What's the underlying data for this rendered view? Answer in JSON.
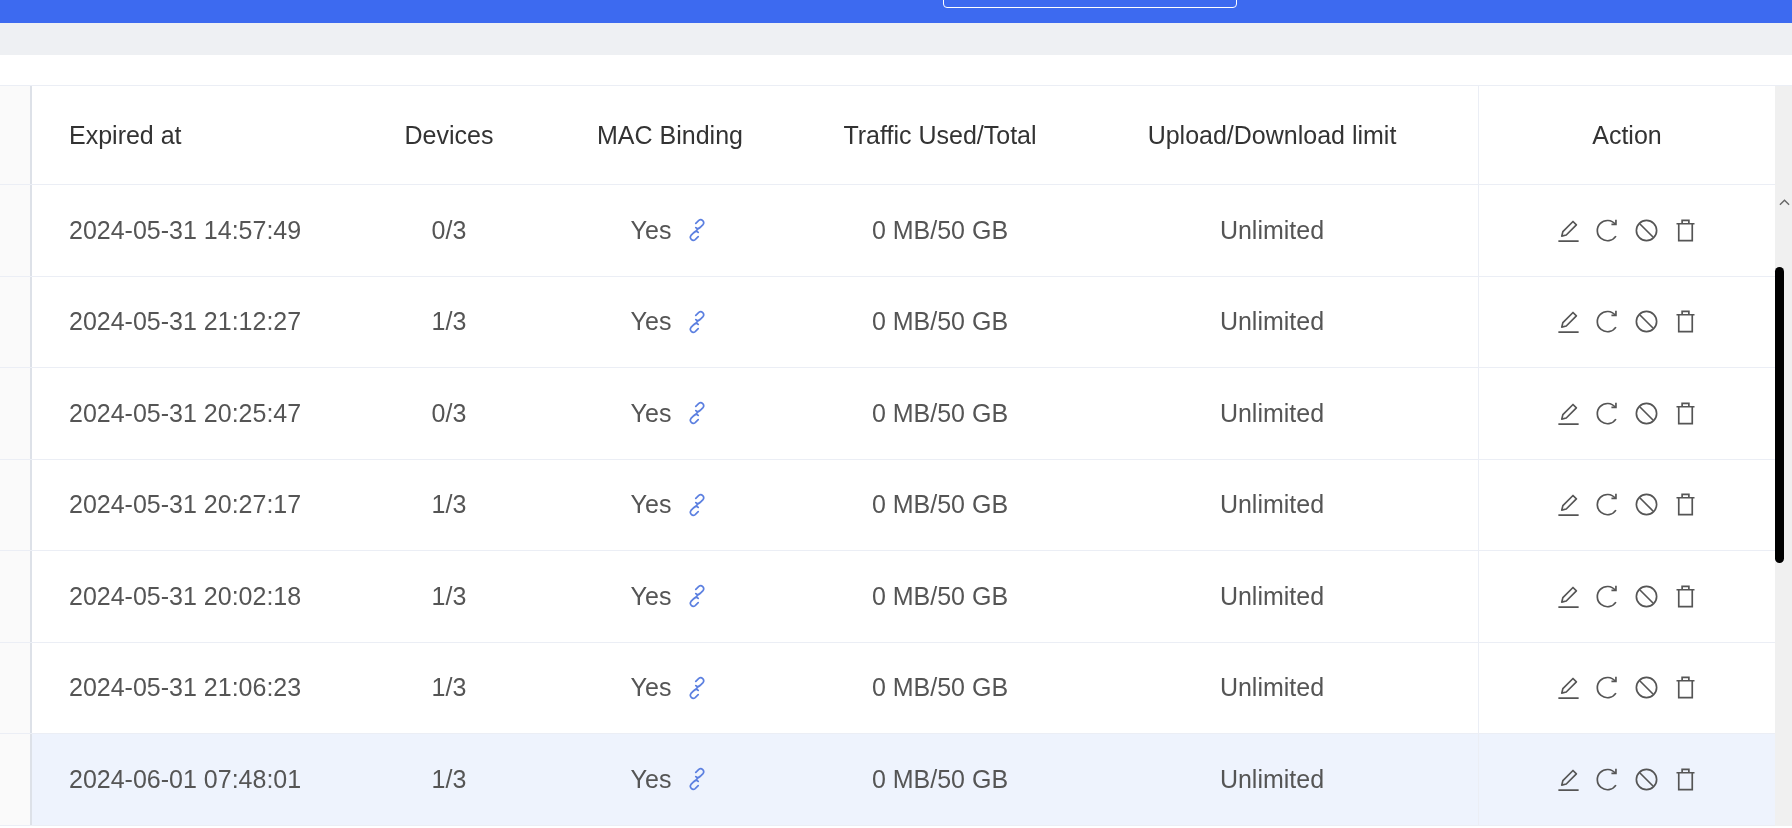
{
  "table": {
    "columns": [
      "Expired at",
      "Devices",
      "MAC Binding",
      "Traffic Used/Total",
      "Upload/Download limit",
      "Action"
    ],
    "rows": [
      {
        "expired_at": "2024-05-31 14:57:49",
        "devices": "0/3",
        "mac_binding": "Yes",
        "traffic": "0 MB/50 GB",
        "limit": "Unlimited",
        "selected": false
      },
      {
        "expired_at": "2024-05-31 21:12:27",
        "devices": "1/3",
        "mac_binding": "Yes",
        "traffic": "0 MB/50 GB",
        "limit": "Unlimited",
        "selected": false
      },
      {
        "expired_at": "2024-05-31 20:25:47",
        "devices": "0/3",
        "mac_binding": "Yes",
        "traffic": "0 MB/50 GB",
        "limit": "Unlimited",
        "selected": false
      },
      {
        "expired_at": "2024-05-31 20:27:17",
        "devices": "1/3",
        "mac_binding": "Yes",
        "traffic": "0 MB/50 GB",
        "limit": "Unlimited",
        "selected": false
      },
      {
        "expired_at": "2024-05-31 20:02:18",
        "devices": "1/3",
        "mac_binding": "Yes",
        "traffic": "0 MB/50 GB",
        "limit": "Unlimited",
        "selected": false
      },
      {
        "expired_at": "2024-05-31 21:06:23",
        "devices": "1/3",
        "mac_binding": "Yes",
        "traffic": "0 MB/50 GB",
        "limit": "Unlimited",
        "selected": false
      },
      {
        "expired_at": "2024-06-01 07:48:01",
        "devices": "1/3",
        "mac_binding": "Yes",
        "traffic": "0 MB/50 GB",
        "limit": "Unlimited",
        "selected": true
      }
    ]
  }
}
